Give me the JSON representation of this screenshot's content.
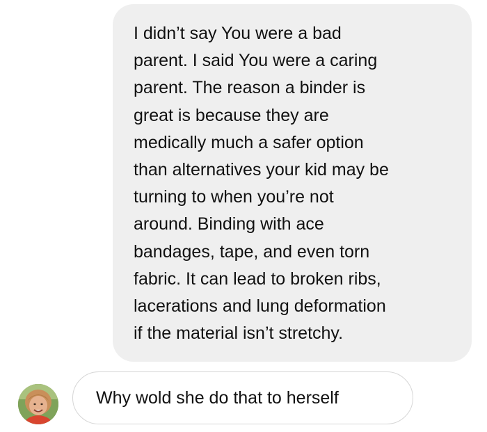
{
  "conversation": {
    "sent_message": {
      "lines": [
        "I didn’t say You were a bad",
        "parent. I said You were a caring",
        "parent. The reason a binder is",
        "great is because they are",
        "medically much a safer option",
        "than alternatives your kid may be",
        "turning to when you’re not",
        "around. Binding with ace",
        "bandages, tape, and even torn",
        "fabric. It can lead to broken ribs,",
        "lacerations and lung deformation",
        "if the material isn’t stretchy."
      ],
      "bubble_color": "#efefef"
    },
    "received_message": {
      "text": "Why wold she do that to herself",
      "avatar_icon": "user-avatar-photo",
      "bubble_border_color": "#d6d6d6"
    }
  }
}
